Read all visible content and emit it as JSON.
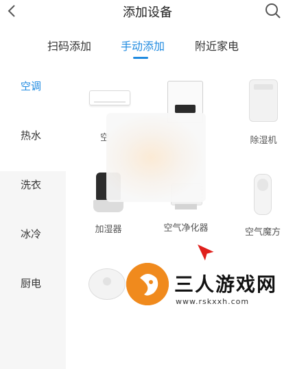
{
  "header": {
    "title": "添加设备",
    "back_icon": "chevron-left-icon",
    "search_icon": "search-icon"
  },
  "tabs": [
    {
      "label": "扫码添加",
      "active": false
    },
    {
      "label": "手动添加",
      "active": true
    },
    {
      "label": "附近家电",
      "active": false
    }
  ],
  "sidebar": {
    "items": [
      {
        "label": "空调",
        "active": true
      },
      {
        "label": "热水",
        "active": false
      },
      {
        "label": "洗衣",
        "active": false
      },
      {
        "label": "冰冷",
        "active": false
      },
      {
        "label": "厨电",
        "active": false
      }
    ]
  },
  "devices": [
    {
      "label": "空",
      "icon": "air-conditioner-icon"
    },
    {
      "label": "",
      "icon": "water-heater-icon"
    },
    {
      "label": "除湿机",
      "icon": "dehumidifier-icon"
    },
    {
      "label": "加湿器",
      "icon": "humidifier-icon"
    },
    {
      "label": "空气净化器",
      "icon": "air-purifier-icon"
    },
    {
      "label": "空气魔方",
      "icon": "air-cube-icon"
    },
    {
      "label": "",
      "icon": "robot-vacuum-icon"
    }
  ],
  "watermark": {
    "text": "三人游戏网",
    "url": "www.rskxxh.com"
  },
  "colors": {
    "accent": "#1f8ae0",
    "watermark": "#f08a1d"
  }
}
